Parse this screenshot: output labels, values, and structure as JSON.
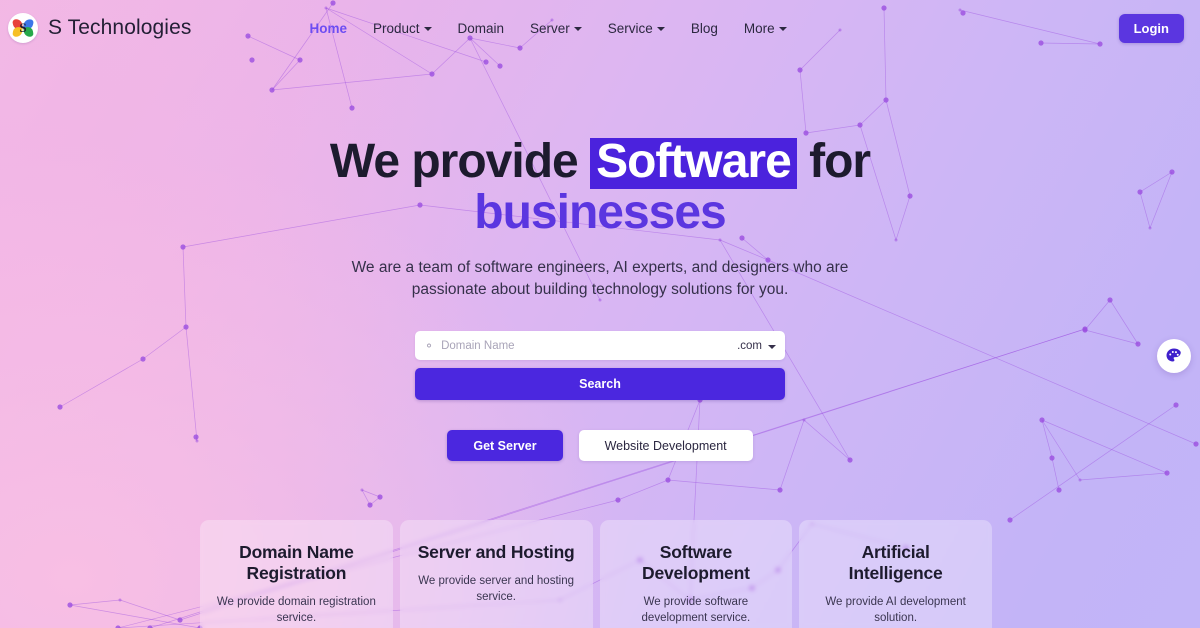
{
  "brand": {
    "name": "S Technologies",
    "logo_icon": "s-technologies-logo-icon",
    "logo_letter": "S"
  },
  "nav": {
    "items": [
      {
        "label": "Home",
        "has_caret": false,
        "active": true
      },
      {
        "label": "Product",
        "has_caret": true,
        "active": false
      },
      {
        "label": "Domain",
        "has_caret": false,
        "active": false
      },
      {
        "label": "Server",
        "has_caret": true,
        "active": false
      },
      {
        "label": "Service",
        "has_caret": true,
        "active": false
      },
      {
        "label": "Blog",
        "has_caret": false,
        "active": false
      },
      {
        "label": "More",
        "has_caret": true,
        "active": false
      }
    ]
  },
  "header": {
    "login_label": "Login"
  },
  "hero": {
    "title_part1": "We provide ",
    "title_highlight": "Software",
    "title_part2": " for",
    "title_line2": "businesses",
    "subtitle": "We are a team of software engineers, AI experts, and designers who are passionate about building technology solutions for you."
  },
  "search": {
    "at_icon": "at-sign-icon",
    "placeholder": "Domain Name",
    "value": "",
    "tld_selected": ".com",
    "tld_caret_icon": "chevron-down-icon",
    "search_label": "Search"
  },
  "cta": {
    "primary_label": "Get Server",
    "secondary_label": "Website Development"
  },
  "cards": [
    {
      "title": "Domain Name Registration",
      "desc": "We provide domain registration service."
    },
    {
      "title": "Server and Hosting",
      "desc": "We provide server and hosting service."
    },
    {
      "title": "Software Development",
      "desc": "We provide software development service."
    },
    {
      "title": "Artificial Intelligence",
      "desc": "We provide AI development solution."
    }
  ],
  "floating_widget": {
    "icon": "color-palette-icon"
  },
  "colors": {
    "accent_purple": "#5b36e0",
    "highlight_purple": "#4b22dd",
    "button_purple": "#4b27df",
    "text_dark": "#1d1b2e",
    "bg_pink": "#f3b9e4",
    "bg_lavender": "#c2b5f8",
    "particle_purple": "#9b4fe0"
  }
}
